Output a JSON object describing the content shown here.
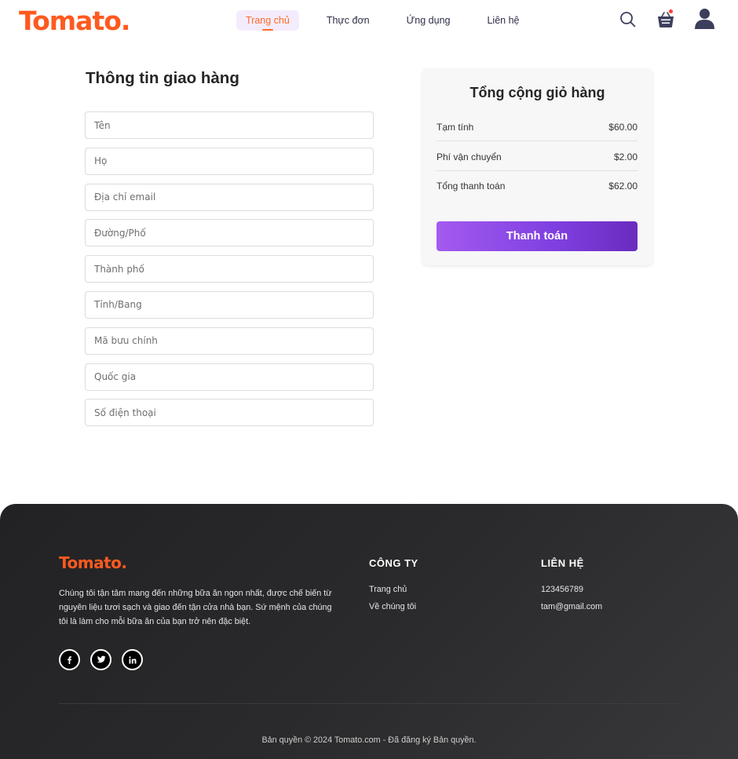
{
  "header": {
    "logo": "Tomato.",
    "nav": [
      {
        "label": "Trang chủ",
        "active": true
      },
      {
        "label": "Thực đơn",
        "active": false
      },
      {
        "label": "Ứng dụng",
        "active": false
      },
      {
        "label": "Liên hệ",
        "active": false
      }
    ],
    "icons": [
      "search-icon",
      "basket-icon",
      "user-avatar-icon"
    ],
    "cart_has_items": true
  },
  "delivery": {
    "title": "Thông tin giao hàng",
    "fields": [
      {
        "name": "first-name",
        "placeholder": "Tên",
        "value": ""
      },
      {
        "name": "last-name",
        "placeholder": "Họ",
        "value": ""
      },
      {
        "name": "email",
        "placeholder": "Địa chỉ email",
        "value": ""
      },
      {
        "name": "street",
        "placeholder": "Đường/Phố",
        "value": ""
      },
      {
        "name": "city",
        "placeholder": "Thành phố",
        "value": ""
      },
      {
        "name": "state",
        "placeholder": "Tỉnh/Bang",
        "value": ""
      },
      {
        "name": "zip-code",
        "placeholder": "Mã bưu chính",
        "value": ""
      },
      {
        "name": "country",
        "placeholder": "Quốc gia",
        "value": ""
      },
      {
        "name": "phone",
        "placeholder": "Số điện thoại",
        "value": ""
      }
    ]
  },
  "cart_totals": {
    "title": "Tổng cộng giỏ hàng",
    "subtotal_label": "Tạm tính",
    "subtotal_value": "$60.00",
    "shipping_label": "Phí vận chuyển",
    "shipping_value": "$2.00",
    "total_label": "Tổng thanh toán",
    "total_value": "$62.00",
    "checkout_label": "Thanh toán"
  },
  "footer": {
    "logo": "Tomato.",
    "about": "Chúng tôi tận tâm mang đến những bữa ăn ngon nhất, được chế biến từ nguyên liệu tươi sạch và giao đến tận cửa nhà bạn. Sứ mệnh của chúng tôi là làm cho mỗi bữa ăn của bạn trở nên đặc biệt.",
    "socials": [
      "facebook-icon",
      "twitter-icon",
      "linkedin-icon"
    ],
    "company_heading": "CÔNG TY",
    "company_links": [
      "Trang chủ",
      "Về chúng tôi"
    ],
    "contact_heading": "LIÊN HỆ",
    "contact_phone": "123456789",
    "contact_email": "tam@gmail.com",
    "copyright": "Bản quyền © 2024 Tomato.com - Đã đăng ký Bản quyền."
  },
  "colors": {
    "brand": "#ff5a1f",
    "accent_purple": "#8a48e6",
    "footer_bg": "#2a2a2c"
  }
}
